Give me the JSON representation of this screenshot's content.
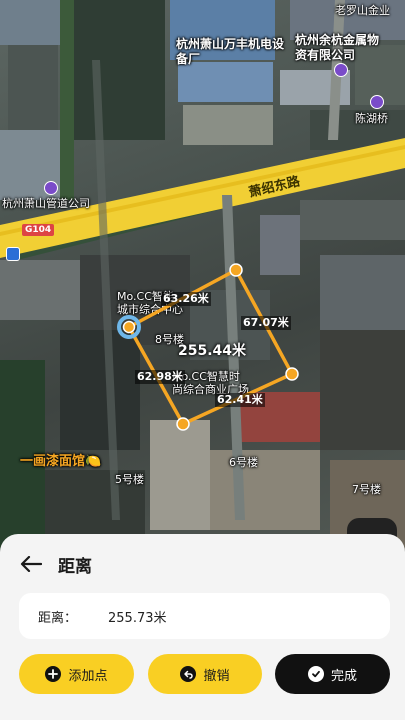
{
  "map": {
    "labels": {
      "poi_top_right": "老罗山金业",
      "factory": "杭州萧山万丰机电设备厂",
      "logistics": "杭州余杭金属物资有限公司",
      "lake": "陈湖桥",
      "road_name": "萧绍东路",
      "pipe_company": "杭州萧山管道公司",
      "highway_shield": "G104",
      "mixc_line1": "Mo.CC智能",
      "mixc_line2": "城市综合中心",
      "b8": "8号楼",
      "mixc2_line1": "Mo.CC智慧时",
      "mixc2_line2": "尚综合商业广场",
      "b6": "6号楼",
      "b5": "5号楼",
      "b7": "7号楼",
      "food": "一画漆面馆🍋"
    },
    "measure": {
      "segments": [
        "63.26米",
        "67.07米",
        "62.41米",
        "62.98米"
      ],
      "total": "255.44米",
      "line_color": "#f5a623",
      "start_color": "#6fb7e9"
    }
  },
  "sheet": {
    "title": "距离",
    "distance_key": "距离：",
    "distance_value": "255.73米",
    "buttons": {
      "add": "添加点",
      "undo": "撤销",
      "done": "完成"
    },
    "accent": "#f9cf23"
  }
}
